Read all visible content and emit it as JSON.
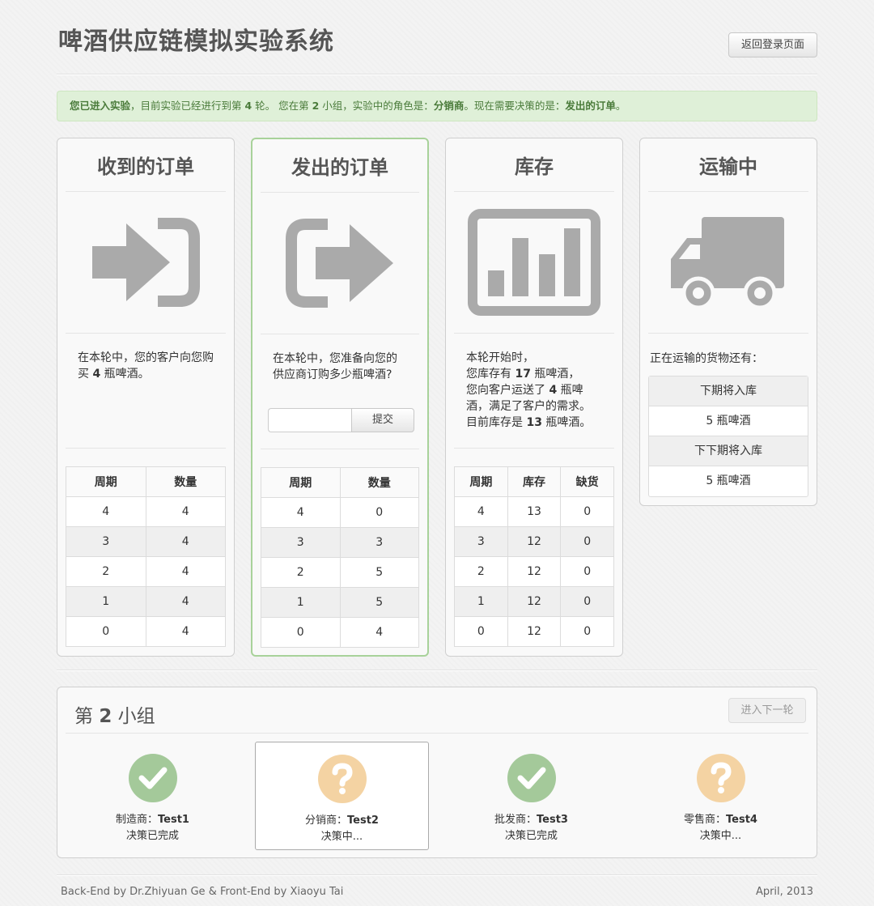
{
  "app": {
    "title": "啤酒供应链模拟实验系统",
    "back_button": "返回登录页面"
  },
  "alert": {
    "p1": "您已进入实验",
    "p2": "，目前实验已经进行到第 ",
    "round": "4",
    "p3": " 轮。 您在第 ",
    "group": "2",
    "p4": " 小组，实验中的角色是：",
    "role": "分销商",
    "p5": "。现在需要决策的是：",
    "decision": "发出的订单",
    "p6": "。"
  },
  "panels": {
    "received": {
      "title": "收到的订单",
      "icon": "sign-in-icon",
      "text_p1": "在本轮中，您的客户向您购买 ",
      "text_qty": "4",
      "text_p2": " 瓶啤酒。",
      "headers": [
        "周期",
        "数量"
      ],
      "rows": [
        [
          "4",
          "4"
        ],
        [
          "3",
          "4"
        ],
        [
          "2",
          "4"
        ],
        [
          "1",
          "4"
        ],
        [
          "0",
          "4"
        ]
      ]
    },
    "sent": {
      "title": "发出的订单",
      "icon": "sign-out-icon",
      "text": "在本轮中，您准备向您的供应商订购多少瓶啤酒?",
      "input_value": "",
      "submit_label": "提交",
      "headers": [
        "周期",
        "数量"
      ],
      "rows": [
        [
          "4",
          "0"
        ],
        [
          "3",
          "3"
        ],
        [
          "2",
          "5"
        ],
        [
          "1",
          "5"
        ],
        [
          "0",
          "4"
        ]
      ]
    },
    "inventory": {
      "title": "库存",
      "icon": "bar-chart-icon",
      "line1": "本轮开始时，",
      "line2_p1": "您库存有 ",
      "line2_qty": "17",
      "line2_p2": " 瓶啤酒，",
      "line3_p1": "您向客户运送了 ",
      "line3_qty": "4",
      "line3_p2": " 瓶啤酒，满足了客户的需求。",
      "line4_p1": "目前库存是 ",
      "line4_qty": "13",
      "line4_p2": " 瓶啤酒。",
      "headers": [
        "周期",
        "库存",
        "缺货"
      ],
      "rows": [
        [
          "4",
          "13",
          "0"
        ],
        [
          "3",
          "12",
          "0"
        ],
        [
          "2",
          "12",
          "0"
        ],
        [
          "1",
          "12",
          "0"
        ],
        [
          "0",
          "12",
          "0"
        ]
      ]
    },
    "transit": {
      "title": "运输中",
      "icon": "truck-icon",
      "text": "正在运输的货物还有：",
      "items": [
        "下期将入库",
        "5 瓶啤酒",
        "下下期将入库",
        "5 瓶啤酒"
      ]
    }
  },
  "group": {
    "title_p1": "第 ",
    "number": "2",
    "title_p2": " 小组",
    "next_button": "进入下一轮",
    "members": [
      {
        "role": "制造商：",
        "name": "Test1",
        "status": "决策已完成",
        "icon": "check-icon",
        "state": "done"
      },
      {
        "role": "分销商：",
        "name": "Test2",
        "status": "决策中...",
        "icon": "question-icon",
        "state": "pending"
      },
      {
        "role": "批发商：",
        "name": "Test3",
        "status": "决策已完成",
        "icon": "check-icon",
        "state": "done"
      },
      {
        "role": "零售商：",
        "name": "Test4",
        "status": "决策中...",
        "icon": "question-icon",
        "state": "pending"
      }
    ],
    "colors": {
      "done": "#a4c99a",
      "pending": "#f4d3a3"
    }
  },
  "footer": {
    "credits": "Back-End by Dr.Zhiyuan Ge & Front-End by Xiaoyu Tai",
    "date": "April, 2013"
  }
}
